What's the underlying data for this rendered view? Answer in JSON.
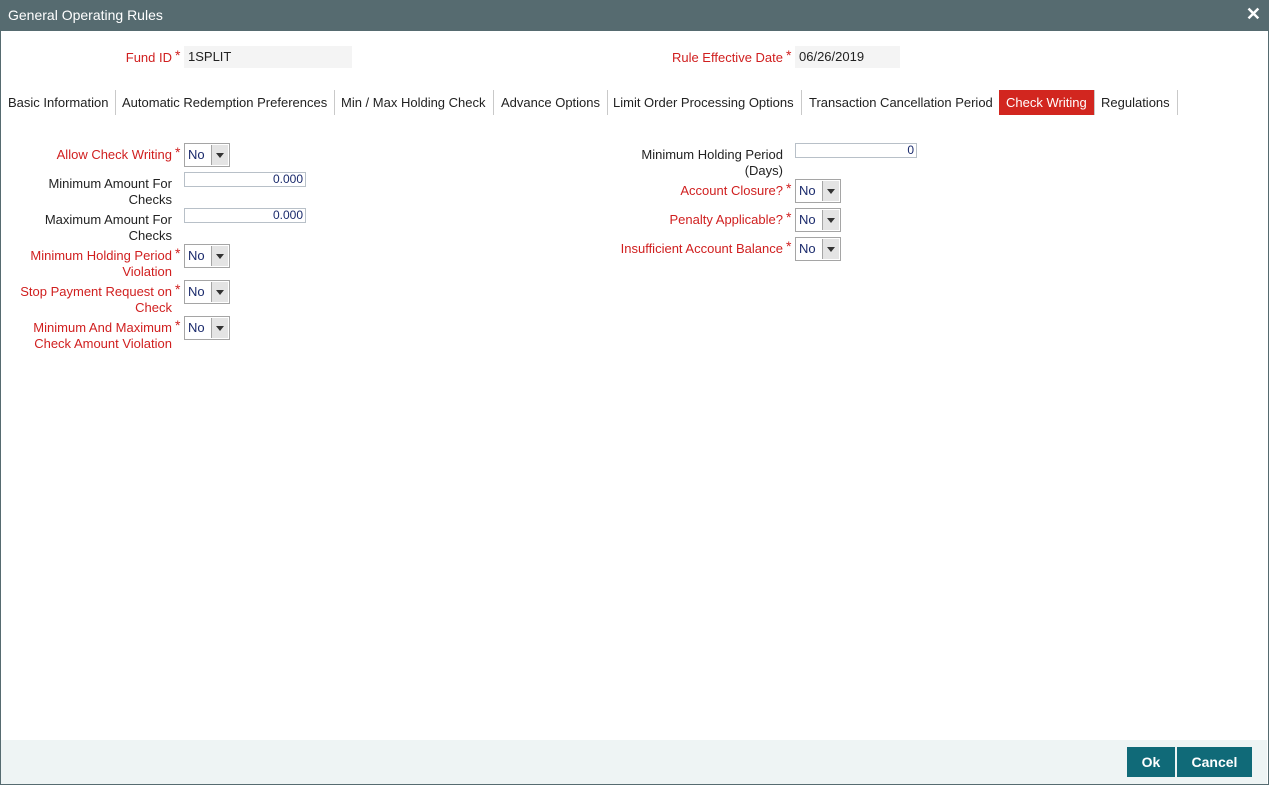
{
  "window": {
    "title": "General Operating Rules"
  },
  "header": {
    "fund_id_label": "Fund ID",
    "fund_id_value": "1SPLIT",
    "rule_date_label": "Rule Effective Date",
    "rule_date_value": "06/26/2019",
    "required_mark": "*"
  },
  "tabs": [
    {
      "label": "Basic Information"
    },
    {
      "label": "Automatic Redemption Preferences"
    },
    {
      "label": "Min / Max Holding Check"
    },
    {
      "label": "Advance Options"
    },
    {
      "label": "Limit Order Processing Options"
    },
    {
      "label": "Transaction Cancellation Period"
    },
    {
      "label": "Check Writing"
    },
    {
      "label": "Regulations"
    }
  ],
  "form": {
    "allow_check_writing": {
      "label": "Allow Check Writing",
      "value": "No"
    },
    "min_amount": {
      "label1": "Minimum Amount For",
      "label2": "Checks",
      "value": "0.000"
    },
    "max_amount": {
      "label1": "Maximum Amount For",
      "label2": "Checks",
      "value": "0.000"
    },
    "min_holding_violation": {
      "label1": "Minimum Holding Period",
      "label2": "Violation",
      "value": "No"
    },
    "stop_payment": {
      "label1": "Stop Payment Request on",
      "label2": "Check",
      "value": "No"
    },
    "min_max_violation": {
      "label1": "Minimum And Maximum",
      "label2": "Check Amount Violation",
      "value": "No"
    },
    "min_holding_days": {
      "label1": "Minimum Holding Period",
      "label2": "(Days)",
      "value": "0"
    },
    "account_closure": {
      "label": "Account Closure?",
      "value": "No"
    },
    "penalty_applicable": {
      "label": "Penalty Applicable?",
      "value": "No"
    },
    "insufficient_balance": {
      "label": "Insufficient Account Balance",
      "value": "No"
    }
  },
  "footer": {
    "ok_label": "Ok",
    "cancel_label": "Cancel"
  },
  "icons": {
    "close": "close-icon",
    "dropdown": "chevron-down-icon"
  },
  "colors": {
    "titlebar": "#566b70",
    "active_tab": "#d2261f",
    "required": "#d01f1f",
    "button": "#106a78"
  }
}
